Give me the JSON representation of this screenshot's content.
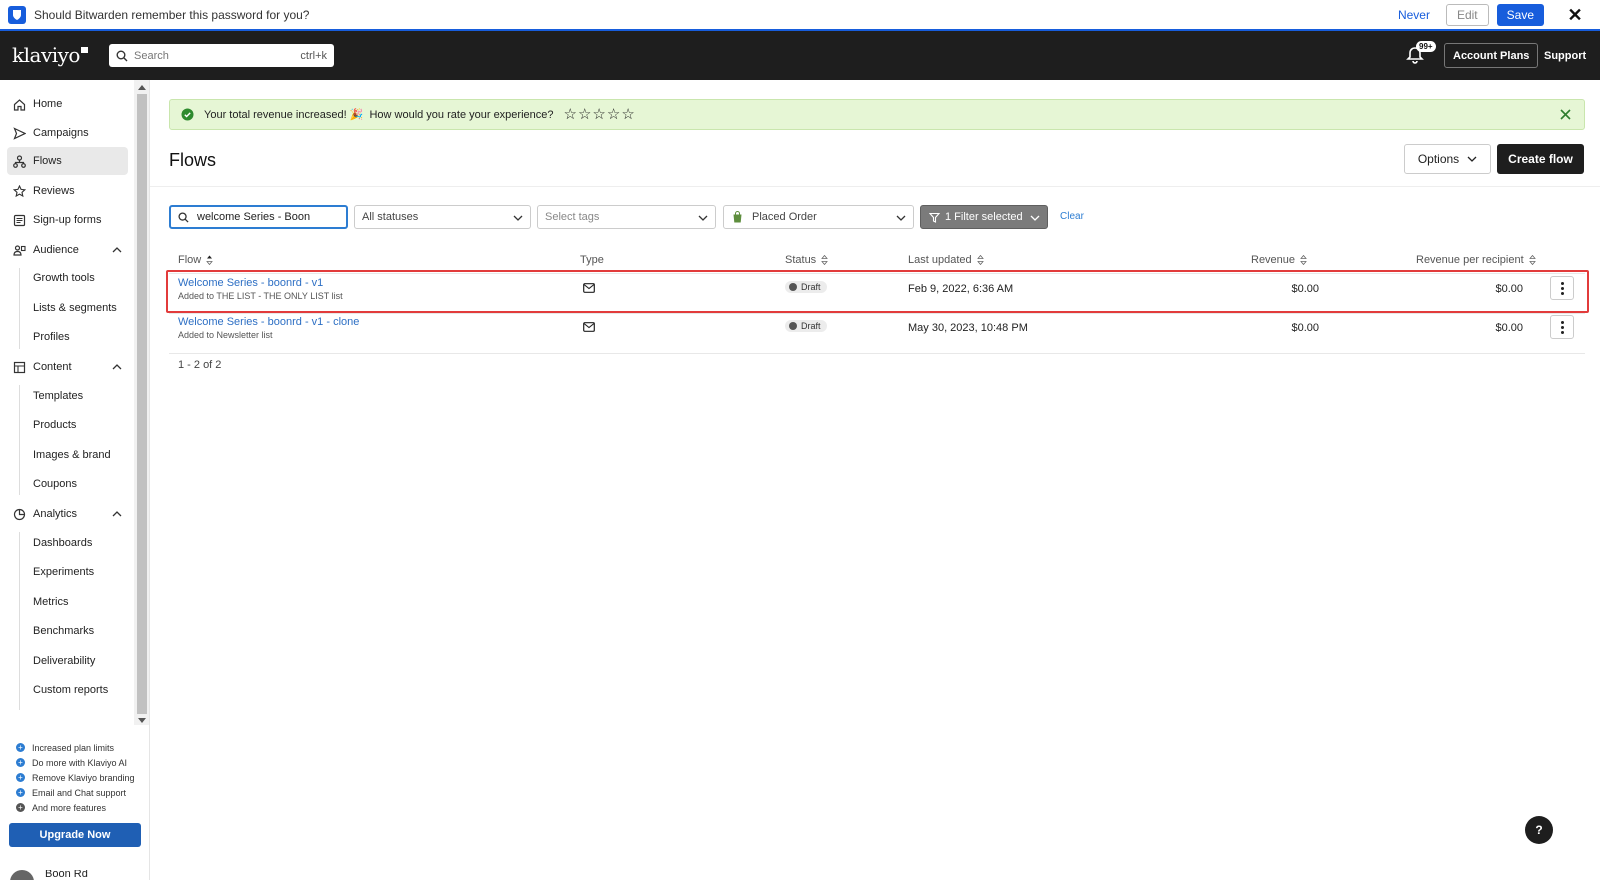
{
  "bitwarden": {
    "prompt": "Should Bitwarden remember this password for you?",
    "never": "Never",
    "edit": "Edit",
    "save": "Save"
  },
  "topnav": {
    "brand": "klaviyo",
    "search_placeholder": "Search",
    "search_shortcut": "ctrl+k",
    "notification_count": "99+",
    "account_plans": "Account Plans",
    "support": "Support"
  },
  "sidebar": {
    "items": [
      {
        "label": "Home",
        "icon": "home-icon"
      },
      {
        "label": "Campaigns",
        "icon": "send-icon"
      },
      {
        "label": "Flows",
        "icon": "flows-icon",
        "active": true
      },
      {
        "label": "Reviews",
        "icon": "star-icon"
      },
      {
        "label": "Sign-up forms",
        "icon": "form-icon"
      },
      {
        "label": "Audience",
        "icon": "audience-icon",
        "expanded": true
      },
      {
        "label": "Content",
        "icon": "content-icon",
        "expanded": true
      },
      {
        "label": "Analytics",
        "icon": "analytics-icon",
        "expanded": true
      }
    ],
    "audience_sub": [
      "Growth tools",
      "Lists & segments",
      "Profiles"
    ],
    "content_sub": [
      "Templates",
      "Products",
      "Images & brand",
      "Coupons"
    ],
    "analytics_sub": [
      "Dashboards",
      "Experiments",
      "Metrics",
      "Benchmarks",
      "Deliverability",
      "Custom reports"
    ],
    "upgrade_features": [
      "Increased plan limits",
      "Do more with Klaviyo AI",
      "Remove Klaviyo branding",
      "Email and Chat support",
      "And more features"
    ],
    "upgrade_button": "Upgrade Now",
    "user_name": "Boon Rd"
  },
  "banner": {
    "message": "Your total revenue increased! 🎉",
    "question": "How would you rate your experience?",
    "stars": [
      "☆",
      "☆",
      "☆",
      "☆",
      "☆"
    ]
  },
  "page": {
    "title": "Flows",
    "options_label": "Options",
    "create_label": "Create flow"
  },
  "filters": {
    "search_value": "welcome Series - Boon",
    "status": "All statuses",
    "tags_placeholder": "Select tags",
    "metric": "Placed Order",
    "selected": "1 Filter selected",
    "clear": "Clear"
  },
  "table": {
    "headers": {
      "flow": "Flow",
      "type": "Type",
      "status": "Status",
      "last_updated": "Last updated",
      "revenue": "Revenue",
      "revenue_per_recipient": "Revenue per recipient"
    },
    "rows": [
      {
        "name": "Welcome Series - boonrd - v1",
        "trigger": "Added to THE LIST - THE ONLY LIST list",
        "status": "Draft",
        "last_updated": "Feb 9, 2022, 6:36 AM",
        "revenue": "$0.00",
        "revenue_per_recipient": "$0.00"
      },
      {
        "name": "Welcome Series - boonrd - v1 - clone",
        "trigger": "Added to Newsletter list",
        "status": "Draft",
        "last_updated": "May 30, 2023, 10:48 PM",
        "revenue": "$0.00",
        "revenue_per_recipient": "$0.00"
      }
    ],
    "pagination": "1 - 2 of 2"
  },
  "help": "?",
  "colors": {
    "accent": "#175ddc",
    "link": "#2d6fc4",
    "banner_bg": "#e6f6d5",
    "highlight": "#e23b3b",
    "nav_bg": "#1e1e1e"
  }
}
